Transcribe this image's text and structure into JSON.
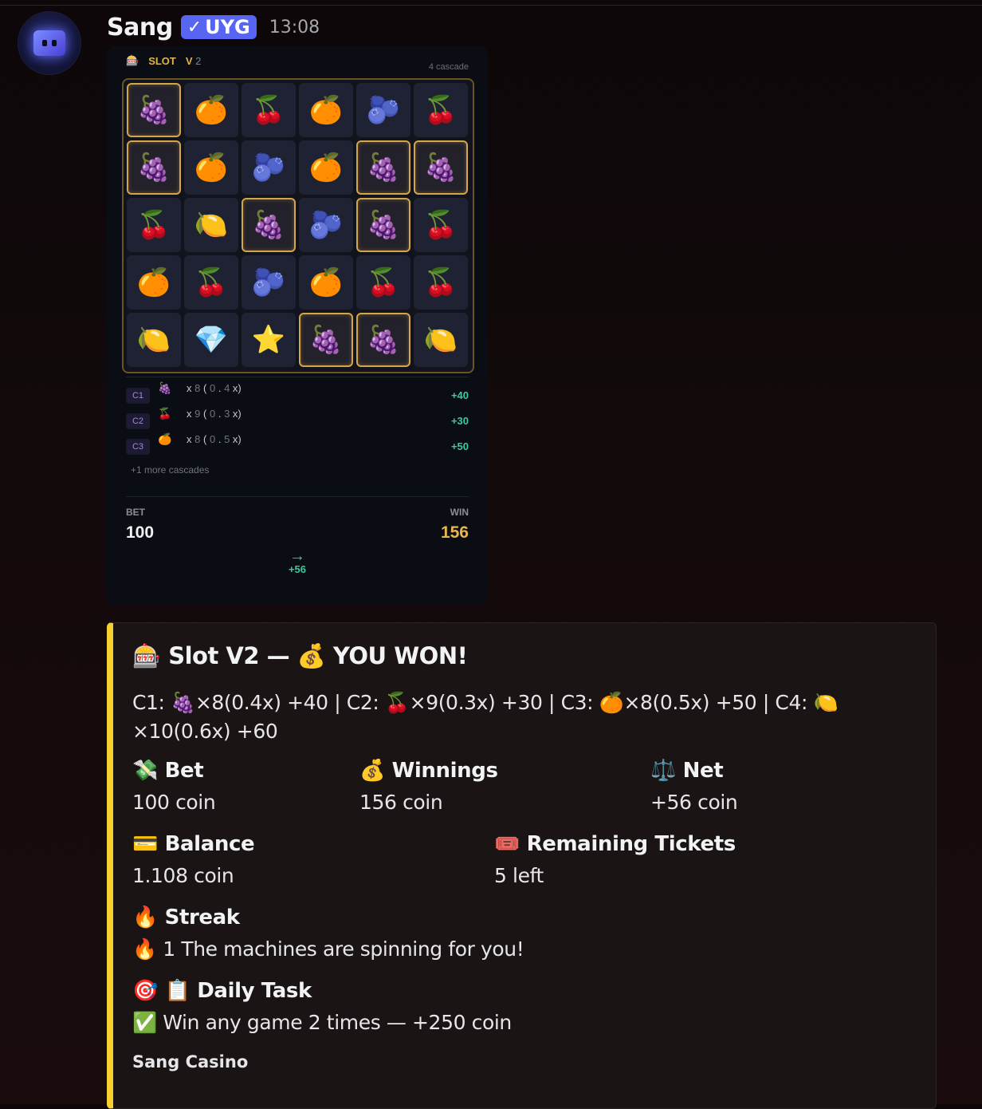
{
  "message": {
    "username": "Sang",
    "badge": "UYG",
    "timestamp": "13:08"
  },
  "slot": {
    "title": "SLOT",
    "version_prefix": "V",
    "version_num": "2",
    "cascade_text": "4 cascade",
    "grid": [
      [
        "grape",
        "orange",
        "cherry",
        "orange",
        "blueberry",
        "cherry"
      ],
      [
        "grape",
        "orange",
        "blueberry",
        "orange",
        "grape",
        "grape"
      ],
      [
        "cherry",
        "lemon",
        "grape",
        "blueberry",
        "grape",
        "cherry"
      ],
      [
        "orange",
        "cherry",
        "blueberry",
        "orange",
        "cherry",
        "cherry"
      ],
      [
        "lemon",
        "diamond",
        "star",
        "grape",
        "grape",
        "lemon"
      ]
    ],
    "highlighted": [
      [
        true,
        false,
        false,
        false,
        false,
        false
      ],
      [
        true,
        false,
        false,
        false,
        true,
        true
      ],
      [
        false,
        false,
        true,
        false,
        true,
        false
      ],
      [
        false,
        false,
        false,
        false,
        false,
        false
      ],
      [
        false,
        false,
        false,
        true,
        true,
        false
      ]
    ],
    "symbols": {
      "grape": "🍇",
      "orange": "🍊",
      "cherry": "🍒",
      "blueberry": "🫐",
      "lemon": "🍋",
      "diamond": "💎",
      "star": "⭐"
    },
    "cascades": [
      {
        "tag": "C1",
        "emoji": "🍇",
        "x": "x",
        "count": "8",
        "open": "(",
        "mult_a": "0",
        "dot": ".",
        "mult_b": "4",
        "close": "x)",
        "win": "+40"
      },
      {
        "tag": "C2",
        "emoji": "🍒",
        "x": "x",
        "count": "9",
        "open": "(",
        "mult_a": "0",
        "dot": ".",
        "mult_b": "3",
        "close": "x)",
        "win": "+30"
      },
      {
        "tag": "C3",
        "emoji": "🍊",
        "x": "x",
        "count": "8",
        "open": "(",
        "mult_a": "0",
        "dot": ".",
        "mult_b": "5",
        "close": "x)",
        "win": "+50"
      }
    ],
    "more_text": "+1 more cascades",
    "bet_label": "BET",
    "bet_value": "100",
    "win_label": "WIN",
    "win_value": "156",
    "arrow": "→",
    "net_value": "+56"
  },
  "embed": {
    "accent_color": "#f6d02e",
    "title": "🎰 Slot V2 — 💰 YOU WON!",
    "description": "C1: 🍇×8(0.4x) +40 | C2: 🍒×9(0.3x) +30 | C3: 🍊×8(0.5x) +50 | C4: 🍋×10(0.6x) +60",
    "fields": {
      "bet": {
        "name": "💸 Bet",
        "value": "100 coin"
      },
      "winnings": {
        "name": "💰 Winnings",
        "value": "156 coin"
      },
      "net": {
        "name": "⚖️ Net",
        "value": "+56 coin"
      },
      "balance": {
        "name": "💳 Balance",
        "value": "1.108 coin"
      },
      "tickets": {
        "name": "🎟️ Remaining Tickets",
        "value": "5 left"
      },
      "streak": {
        "name": "🔥 Streak",
        "value": "🔥 1 The machines are spinning for you!"
      },
      "daily": {
        "name": "🎯 📋 Daily Task",
        "value": "✅ Win any game 2 times — +250 coin"
      }
    },
    "footer": "Sang Casino"
  }
}
